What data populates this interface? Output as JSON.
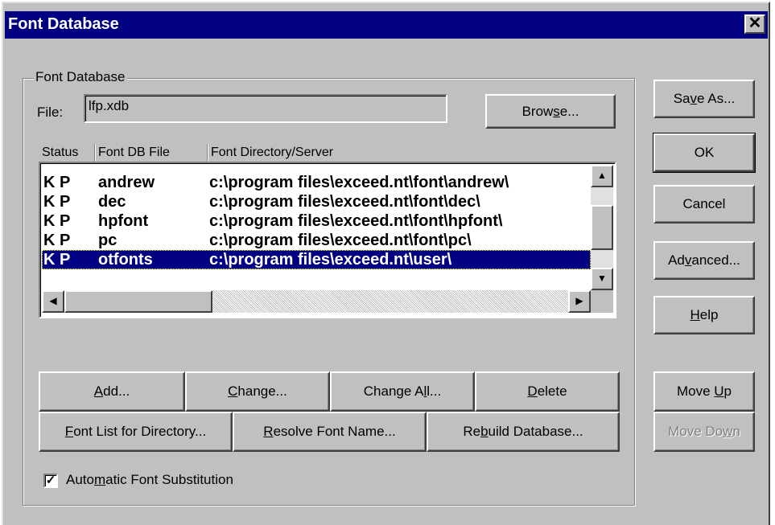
{
  "window": {
    "title": "Font Database",
    "close_glyph": "✕"
  },
  "group": {
    "label": "Font Database"
  },
  "file": {
    "label": "File:",
    "value": "lfp.xdb",
    "browse": "Browse..."
  },
  "columns": [
    "Status",
    "Font DB File",
    "Font Directory/Server"
  ],
  "rows": [
    {
      "status": "K P",
      "name": "andrew",
      "path": "c:\\program files\\exceed.nt\\font\\andrew\\"
    },
    {
      "status": "K P",
      "name": "dec",
      "path": "c:\\program files\\exceed.nt\\font\\dec\\"
    },
    {
      "status": "K P",
      "name": "hpfont",
      "path": "c:\\program files\\exceed.nt\\font\\hpfont\\"
    },
    {
      "status": "K P",
      "name": "pc",
      "path": "c:\\program files\\exceed.nt\\font\\pc\\"
    },
    {
      "status": "K P",
      "name": "otfonts",
      "path": "c:\\program files\\exceed.nt\\user\\"
    }
  ],
  "selected_row": 4,
  "actions": {
    "add": "Add...",
    "change": "Change...",
    "change_all": "Change All...",
    "delete": "Delete",
    "font_list": "Font List for Directory...",
    "resolve": "Resolve Font Name...",
    "rebuild": "Rebuild Database..."
  },
  "side": {
    "save_as": "Save As...",
    "ok": "OK",
    "cancel": "Cancel",
    "advanced": "Advanced...",
    "help": "Help",
    "move_up": "Move Up",
    "move_down": "Move Down"
  },
  "substitution": {
    "label": "Automatic Font Substitution",
    "checked": true
  },
  "icons": [
    "close-icon",
    "scroll-up-icon",
    "scroll-down-icon",
    "scroll-left-icon",
    "scroll-right-icon",
    "checkmark-icon"
  ],
  "colors": {
    "titlebar": "#000080",
    "face": "#c0c0c0",
    "selection": "#000080"
  }
}
